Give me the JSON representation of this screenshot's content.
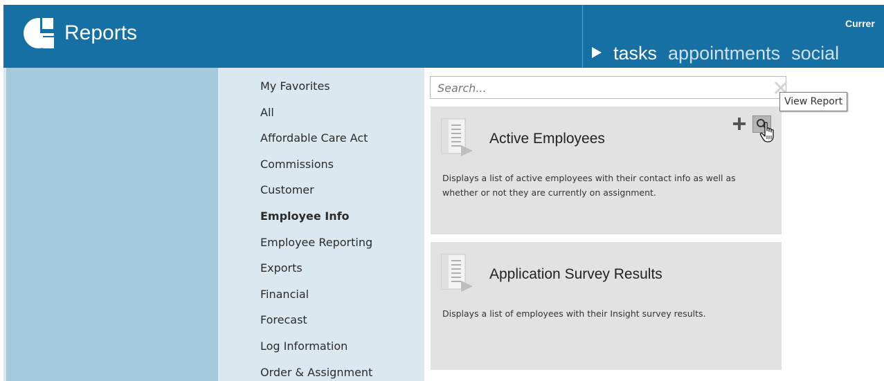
{
  "header": {
    "app_title": "Reports",
    "current_label": "Currer",
    "nav": [
      {
        "label": "tasks",
        "active": true
      },
      {
        "label": "appointments",
        "active": false
      },
      {
        "label": "social",
        "active": false
      }
    ]
  },
  "categories": [
    {
      "label": "My Favorites"
    },
    {
      "label": "All"
    },
    {
      "label": "Affordable Care Act"
    },
    {
      "label": "Commissions"
    },
    {
      "label": "Customer"
    },
    {
      "label": "Employee Info",
      "active": true
    },
    {
      "label": "Employee Reporting"
    },
    {
      "label": "Exports"
    },
    {
      "label": "Financial"
    },
    {
      "label": "Forecast"
    },
    {
      "label": "Log Information"
    },
    {
      "label": "Order & Assignment"
    }
  ],
  "search": {
    "placeholder": "Search...",
    "value": ""
  },
  "tooltip": "View Report",
  "reports": [
    {
      "title": "Active Employees",
      "description": "Displays a list of active employees with their contact info as well as whether or not they are currently on assignment."
    },
    {
      "title": "Application Survey Results",
      "description": "Displays a list of employees with their Insight survey results."
    }
  ],
  "icons": {
    "logo": "reports-logo-icon",
    "nav_marker": "play-icon",
    "clear": "close-icon",
    "add": "plus-icon",
    "view": "magnifier-icon",
    "cursor": "hand-cursor-icon",
    "report": "document-icon"
  },
  "colors": {
    "header": "#1670a3",
    "left_panel": "#a5cadd",
    "categories_bg": "#dce8f0",
    "card_bg": "#e2e2e2"
  }
}
